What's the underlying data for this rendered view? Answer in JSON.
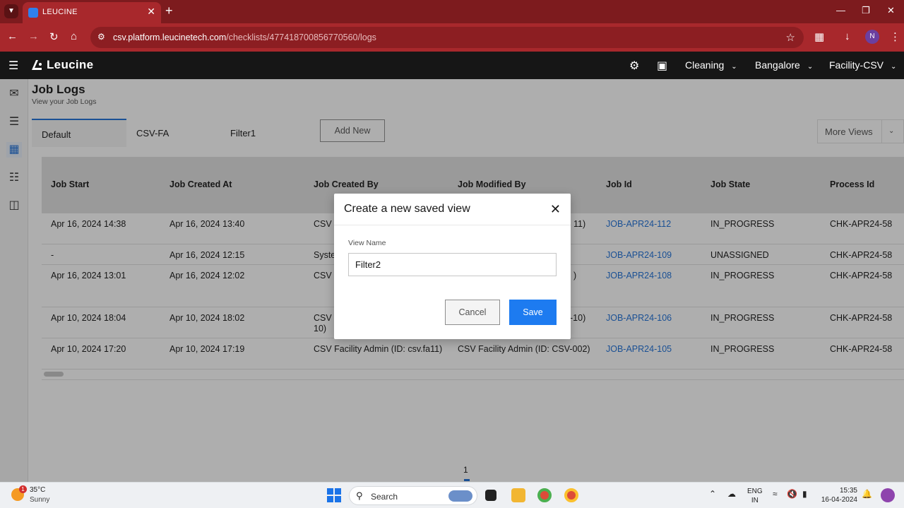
{
  "browser": {
    "tab_title": "LEUCINE",
    "url_host": "csv.platform.leucinetech.com",
    "url_path": "/checklists/477418700856770560/logs",
    "profile_initial": "N"
  },
  "app": {
    "logo_text": "Leucine",
    "header": {
      "use_case": "Cleaning",
      "site": "Bangalore",
      "facility": "Facility-CSV"
    }
  },
  "page": {
    "title": "Job Logs",
    "subtitle": "View your Job Logs",
    "tabs": [
      {
        "label": "Default"
      },
      {
        "label": "CSV-FA"
      },
      {
        "label": "Filter1"
      }
    ],
    "add_new_label": "Add New",
    "more_views_label": "More Views"
  },
  "table": {
    "columns": [
      "Job Start",
      "Job Created At",
      "Job Created By",
      "Job Modified By",
      "Job Id",
      "Job State",
      "Process Id"
    ],
    "rows": [
      {
        "start": "Apr 16, 2024 14:38",
        "created_at": "Apr 16, 2024 13:40",
        "created_by": "CSV F",
        "modified_by": "11)",
        "job_id": "JOB-APR24-112",
        "state": "IN_PROGRESS",
        "process_id": "CHK-APR24-58"
      },
      {
        "start": "-",
        "created_at": "Apr 16, 2024 12:15",
        "created_by": "Syste",
        "modified_by": "",
        "job_id": "JOB-APR24-109",
        "state": "UNASSIGNED",
        "process_id": "CHK-APR24-58"
      },
      {
        "start": "Apr 16, 2024 13:01",
        "created_at": "Apr 16, 2024 12:02",
        "created_by": "CSV F",
        "modified_by": ")",
        "job_id": "JOB-APR24-108",
        "state": "IN_PROGRESS",
        "process_id": "CHK-APR24-58"
      },
      {
        "start": "Apr 10, 2024 18:04",
        "created_at": "Apr 10, 2024 18:02",
        "created_by": "CSV F",
        "created_by_2": "10)",
        "modified_by": "-10)",
        "job_id": "JOB-APR24-106",
        "state": "IN_PROGRESS",
        "process_id": "CHK-APR24-58"
      },
      {
        "start": "Apr 10, 2024 17:20",
        "created_at": "Apr 10, 2024 17:19",
        "created_by": "CSV Facility Admin (ID: csv.fa11)",
        "modified_by": "CSV Facility Admin (ID: CSV-002)",
        "job_id": "JOB-APR24-105",
        "state": "IN_PROGRESS",
        "process_id": "CHK-APR24-58"
      }
    ],
    "page_number": "1"
  },
  "modal": {
    "title": "Create a new saved view",
    "field_label": "View Name",
    "field_value": "Filter2",
    "cancel_label": "Cancel",
    "save_label": "Save"
  },
  "taskbar": {
    "weather_temp": "35°C",
    "weather_condition": "Sunny",
    "weather_badge": "1",
    "search_label": "Search",
    "lang_1": "ENG",
    "lang_2": "IN",
    "time": "15:35",
    "date": "16-04-2024"
  },
  "colors": {
    "browser_frame": "#7d1b1e",
    "app_header": "#161616",
    "link": "#1d6fd8",
    "primary_button": "#1d7bf0"
  }
}
